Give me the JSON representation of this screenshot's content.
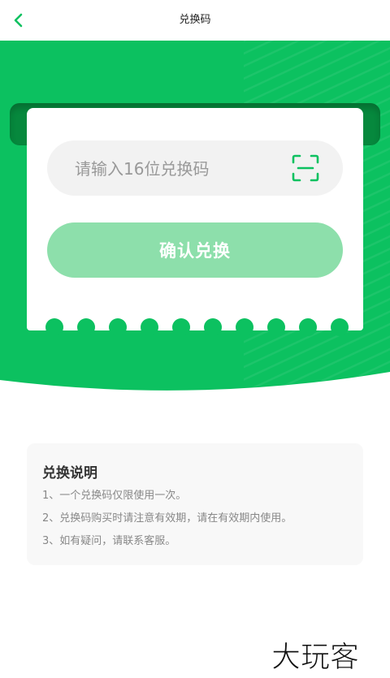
{
  "header": {
    "title": "兑换码",
    "back_icon": "chevron-left-icon"
  },
  "redeem": {
    "input_placeholder": "请输入16位兑换码",
    "input_value": "",
    "scan_icon": "scan-icon",
    "confirm_label": "确认兑换"
  },
  "instructions": {
    "title": "兑换说明",
    "items": [
      "1、一个兑换码仅限使用一次。",
      "2、兑换码购买时请注意有效期，请在有效期内使用。",
      "3、如有疑问，请联系客服。"
    ]
  },
  "watermark": {
    "text": "大玩客"
  },
  "colors": {
    "brand_green": "#0cc160",
    "button_disabled": "#8ddfab",
    "slot_dark": "#06883d"
  }
}
